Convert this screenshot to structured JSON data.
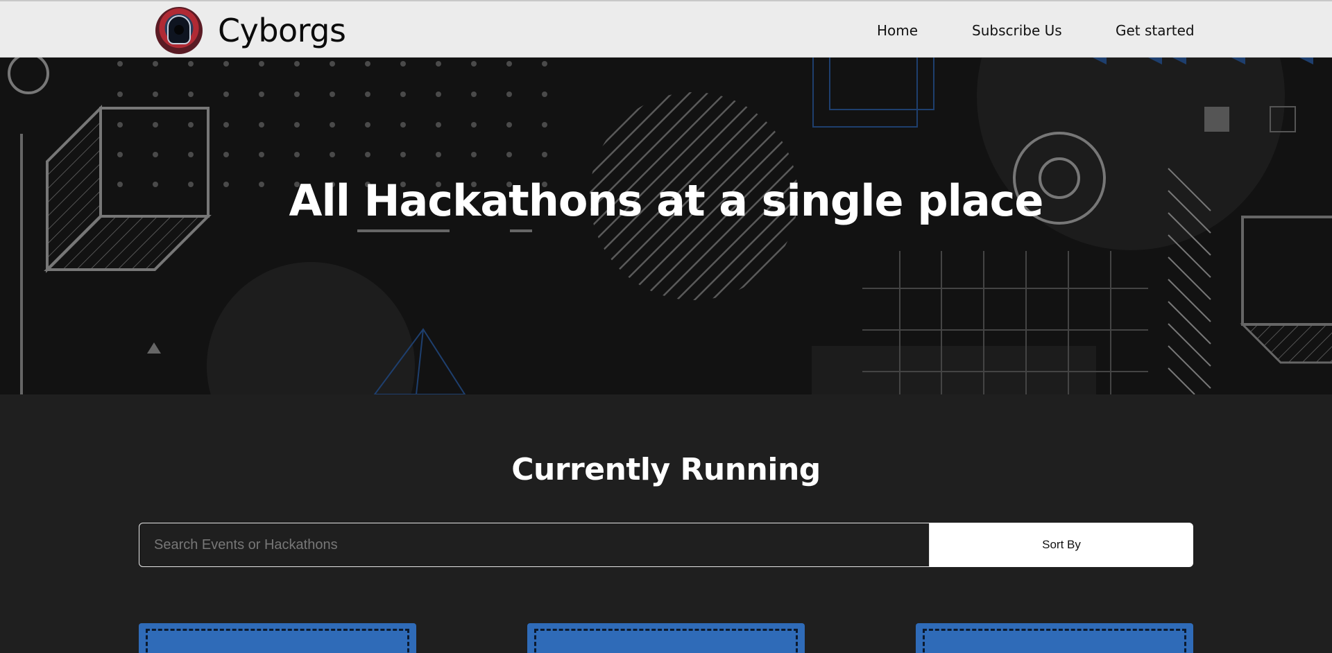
{
  "brand": {
    "name": "Cyborgs",
    "logo_icon": "hooded-cyborg-logo-icon"
  },
  "nav": {
    "items": [
      {
        "label": "Home"
      },
      {
        "label": "Subscribe Us"
      },
      {
        "label": "Get started"
      }
    ]
  },
  "hero": {
    "title": "All Hackathons at a single place"
  },
  "events": {
    "title": "Currently Running",
    "search_placeholder": "Search Events or Hackathons",
    "search_value": "",
    "sort_label": "Sort By",
    "card_count_visible": 3
  },
  "colors": {
    "navbar_bg": "#ececec",
    "hero_bg": "#121212",
    "page_bg": "#1f1f1f",
    "card_accent": "#2f6bb8",
    "decor_blue": "#1e3f6e"
  }
}
